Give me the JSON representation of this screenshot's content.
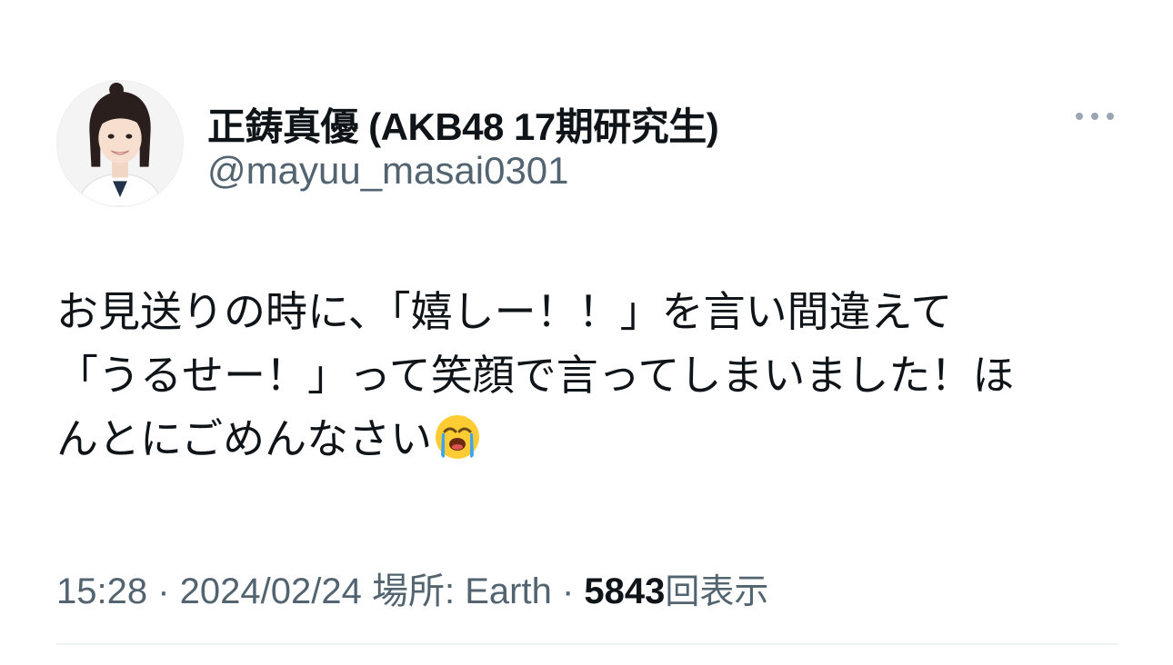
{
  "author": {
    "display_name": "正鋳真優 (AKB48 17期研究生)",
    "handle": "@mayuu_masai0301",
    "avatar_icon": "profile-photo"
  },
  "more_icon": "more-horizontal-icon",
  "tweet": {
    "lines": [
      "お見送りの時に、「嬉しー！！」を言い間違えて",
      "「うるせー！」って笑顔で言ってしまいました！ほ",
      "んとにごめんなさい"
    ],
    "emoji": "loudly-crying-face"
  },
  "meta": {
    "time": "15:28",
    "sep1": " · ",
    "date": "2024/02/24",
    "location_label": "場所:",
    "location": "Earth",
    "sep2": " · ",
    "views_count": "5843",
    "views_label": "回表示"
  },
  "colors": {
    "primary_text": "#0f1419",
    "secondary_text": "#536471",
    "divider": "#eff3f4"
  }
}
